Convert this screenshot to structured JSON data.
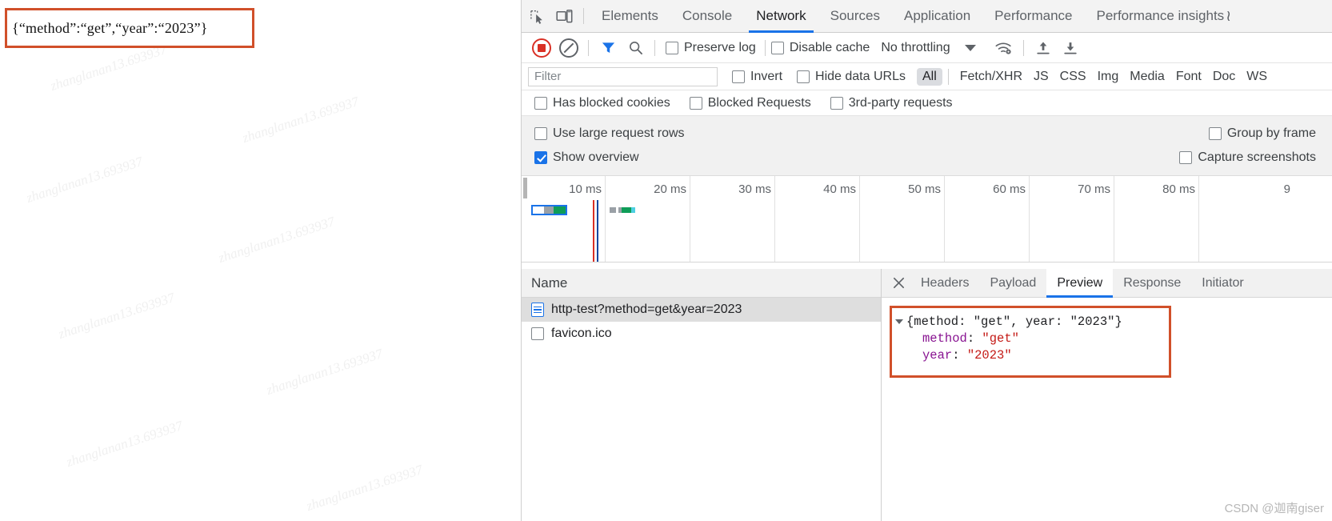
{
  "page": {
    "response_json": "{“method”:“get”,“year”:“2023”}",
    "watermark": "zhanglanan13.693937"
  },
  "devtools": {
    "icons": {
      "inspect": "inspect-element-icon",
      "device": "device-toolbar-icon",
      "record": "record-stop-icon",
      "clear": "clear-network-log-icon",
      "filter": "filter-funnel-icon",
      "search": "search-icon",
      "network_conditions": "wifi-settings-icon",
      "import": "import-har-icon",
      "export": "export-har-icon"
    },
    "tabs": [
      {
        "label": "Elements",
        "active": false
      },
      {
        "label": "Console",
        "active": false
      },
      {
        "label": "Network",
        "active": true
      },
      {
        "label": "Sources",
        "active": false
      },
      {
        "label": "Application",
        "active": false
      },
      {
        "label": "Performance",
        "active": false
      },
      {
        "label": "Performance insights",
        "active": false
      }
    ],
    "beta_mark": "≀",
    "toolbar": {
      "preserve_log": {
        "label": "Preserve log",
        "checked": false
      },
      "disable_cache": {
        "label": "Disable cache",
        "checked": false
      },
      "throttling": "No throttling"
    },
    "filterbar": {
      "placeholder": "Filter",
      "value": "",
      "invert": {
        "label": "Invert",
        "checked": false
      },
      "hide_data_urls": {
        "label": "Hide data URLs",
        "checked": false
      },
      "types": [
        {
          "label": "All",
          "selected": true
        },
        {
          "label": "Fetch/XHR",
          "selected": false
        },
        {
          "label": "JS",
          "selected": false
        },
        {
          "label": "CSS",
          "selected": false
        },
        {
          "label": "Img",
          "selected": false
        },
        {
          "label": "Media",
          "selected": false
        },
        {
          "label": "Font",
          "selected": false
        },
        {
          "label": "Doc",
          "selected": false
        },
        {
          "label": "WS",
          "selected": false
        }
      ]
    },
    "chkbar": {
      "has_blocked_cookies": {
        "label": "Has blocked cookies",
        "checked": false
      },
      "blocked_requests": {
        "label": "Blocked Requests",
        "checked": false
      },
      "third_party": {
        "label": "3rd-party requests",
        "checked": false
      }
    },
    "settings": {
      "use_large_request_rows": {
        "label": "Use large request rows",
        "checked": false
      },
      "group_by_frame": {
        "label": "Group by frame",
        "checked": false
      },
      "show_overview": {
        "label": "Show overview",
        "checked": true
      },
      "capture_screenshots": {
        "label": "Capture screenshots",
        "checked": false
      }
    },
    "overview": {
      "ticks": [
        "10 ms",
        "20 ms",
        "30 ms",
        "40 ms",
        "50 ms",
        "60 ms",
        "70 ms",
        "80 ms",
        "9"
      ],
      "dom_content_loaded_color": "#0d47a1",
      "load_event_color": "#d93025"
    },
    "requests": {
      "column_name": "Name",
      "rows": [
        {
          "name": "http-test?method=get&year=2023",
          "selected": true,
          "icon": "document-icon"
        },
        {
          "name": "favicon.ico",
          "selected": false,
          "icon": "generic-file-icon"
        }
      ]
    },
    "detail": {
      "tabs": [
        {
          "label": "Headers",
          "active": false
        },
        {
          "label": "Payload",
          "active": false
        },
        {
          "label": "Preview",
          "active": true
        },
        {
          "label": "Response",
          "active": false
        },
        {
          "label": "Initiator",
          "active": false
        }
      ],
      "preview": {
        "root_summary": "{method: \"get\", year: \"2023\"}",
        "entries": [
          {
            "key": "method",
            "value": "\"get\""
          },
          {
            "key": "year",
            "value": "\"2023\""
          }
        ]
      }
    }
  },
  "footer": {
    "credit": "CSDN @迦南giser"
  },
  "colors": {
    "accent": "#1a73e8",
    "annotation": "#d1502a",
    "record": "#d93025"
  }
}
